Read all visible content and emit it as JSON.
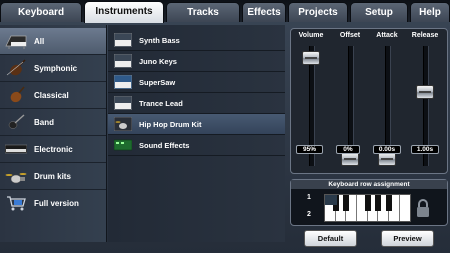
{
  "tabs": [
    "Keyboard",
    "Instruments",
    "Tracks",
    "Effects",
    "Projects",
    "Setup",
    "Help"
  ],
  "active_tab": "Instruments",
  "categories": [
    {
      "label": "All",
      "icon": "piano-icon"
    },
    {
      "label": "Symphonic",
      "icon": "violin-icon"
    },
    {
      "label": "Classical",
      "icon": "violin-icon"
    },
    {
      "label": "Band",
      "icon": "guitar-icon"
    },
    {
      "label": "Electronic",
      "icon": "synth-keyboard-icon"
    },
    {
      "label": "Drum kits",
      "icon": "drum-kit-icon"
    },
    {
      "label": "Full version",
      "icon": "shopping-cart-icon"
    }
  ],
  "active_category": "All",
  "instruments": [
    {
      "label": "Synth Bass",
      "icon": "synth-icon"
    },
    {
      "label": "Juno Keys",
      "icon": "synth-icon"
    },
    {
      "label": "SuperSaw",
      "icon": "synth-icon"
    },
    {
      "label": "Trance Lead",
      "icon": "synth-icon"
    },
    {
      "label": "Hip Hop Drum Kit",
      "icon": "drum-kit-icon"
    },
    {
      "label": "Sound Effects",
      "icon": "sound-effects-icon"
    }
  ],
  "active_instrument": "Hip Hop Drum Kit",
  "sliders": [
    {
      "label": "Volume",
      "value": "95%",
      "level": 0.95
    },
    {
      "label": "Offset",
      "value": "0%",
      "level": 0.0
    },
    {
      "label": "Attack",
      "value": "0.00s",
      "level": 0.0
    },
    {
      "label": "Release",
      "value": "1.00s",
      "level": 0.63
    }
  ],
  "keyboard_assignment": {
    "title": "Keyboard row assignment",
    "rows": [
      "1",
      "2"
    ],
    "lock_icon": "lock-icon"
  },
  "buttons": {
    "default": "Default",
    "preview": "Preview"
  },
  "colors": {
    "accent": "#ffffff",
    "active_row": "#485a72",
    "panel_bg": "#20262f"
  }
}
